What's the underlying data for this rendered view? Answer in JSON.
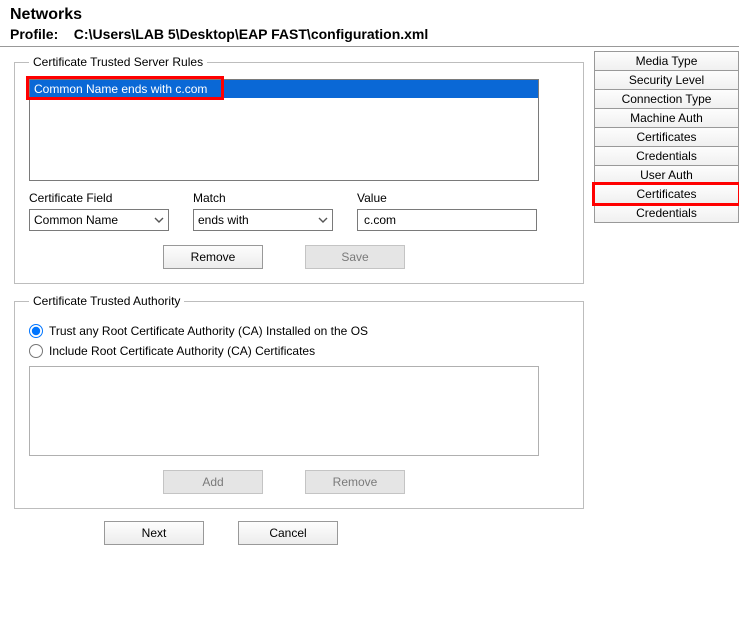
{
  "header": {
    "title": "Networks",
    "profile_label": "Profile:",
    "profile_path": "C:\\Users\\LAB 5\\Desktop\\EAP FAST\\configuration.xml"
  },
  "tabs": [
    {
      "label": "Media Type"
    },
    {
      "label": "Security Level"
    },
    {
      "label": "Connection Type"
    },
    {
      "label": "Machine Auth"
    },
    {
      "label": "Certificates"
    },
    {
      "label": "Credentials"
    },
    {
      "label": "User Auth"
    },
    {
      "label": "Certificates",
      "highlight": true
    },
    {
      "label": "Credentials"
    }
  ],
  "rules_group": {
    "legend": "Certificate Trusted Server Rules",
    "items": [
      "Common Name ends with c.com"
    ],
    "field_label": "Certificate Field",
    "match_label": "Match",
    "value_label": "Value",
    "field_value": "Common Name",
    "match_value": "ends with",
    "value_input": "c.com",
    "remove_btn": "Remove",
    "save_btn": "Save"
  },
  "authority_group": {
    "legend": "Certificate Trusted Authority",
    "opt_trust_any": "Trust any Root Certificate Authority (CA) Installed on the OS",
    "opt_include": "Include Root Certificate Authority (CA) Certificates",
    "add_btn": "Add",
    "remove_btn": "Remove"
  },
  "footer": {
    "next": "Next",
    "cancel": "Cancel"
  }
}
